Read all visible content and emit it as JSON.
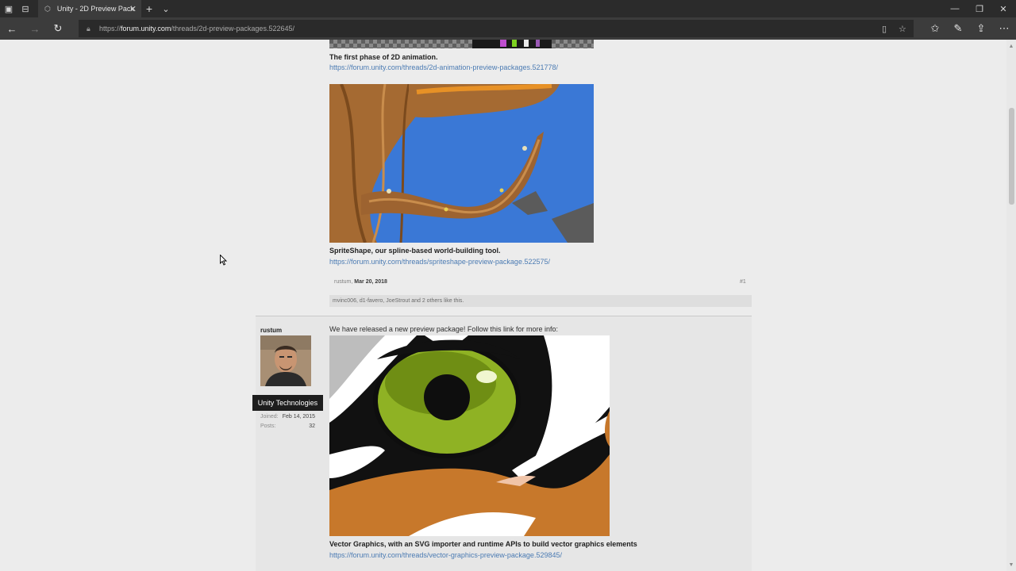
{
  "browser": {
    "tab_title": "Unity - 2D Preview Pack",
    "url_prefix": "https://",
    "url_host": "forum.unity.com",
    "url_path": "/threads/2d-preview-packages.522645/"
  },
  "post1": {
    "caption_animation": "The first phase of 2D animation.",
    "link_animation": "https://forum.unity.com/threads/2d-animation-preview-packages.521778/",
    "caption_spriteshape": "SpriteShape, our spline-based world-building tool.",
    "link_spriteshape": "https://forum.unity.com/threads/spriteshape-preview-package.522575/",
    "author": "rustum",
    "date": "Mar 20, 2018",
    "post_number": "#1",
    "likes": "mvinc006, d1-favero, JoeStrout and 2 others like this."
  },
  "post2": {
    "username": "rustum",
    "badge": "Unity Technologies",
    "joined_label": "Joined:",
    "joined_value": "Feb 14, 2015",
    "posts_label": "Posts:",
    "posts_value": "32",
    "intro": "We have released a new preview package! Follow this link for more info:",
    "caption_vector": "Vector Graphics, with an SVG importer and runtime APIs to build vector graphics elements",
    "link_vector": "https://forum.unity.com/threads/vector-graphics-preview-package.529845/"
  },
  "colors": {
    "link": "#4b7bb3",
    "badge_bg": "#1d1d1d",
    "spriteshape_sky": "#3a78d6",
    "eye_green": "#8fb224",
    "tiger_orange": "#c7782b"
  }
}
